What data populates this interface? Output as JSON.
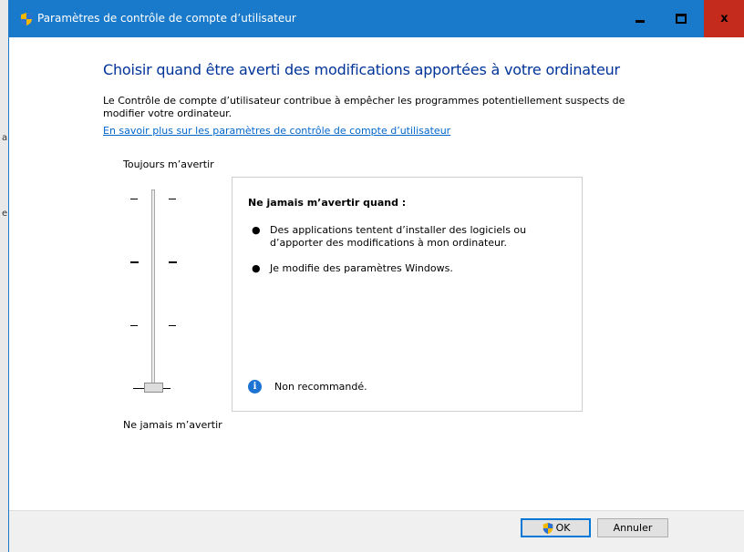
{
  "window": {
    "title": "Paramètres de contrôle de compte d’utilisateur",
    "accent": "#1979ca"
  },
  "main": {
    "heading": "Choisir quand être averti des modifications apportées à votre ordinateur",
    "description": "Le Contrôle de compte d’utilisateur contribue à empêcher les programmes potentiellement suspects de modifier votre ordinateur.",
    "learn_more_link": "En savoir plus sur les paramètres de contrôle de compte d’utilisateur"
  },
  "slider": {
    "top_label": "Toujours m’avertir",
    "bottom_label": "Ne jamais m’avertir",
    "levels": 4,
    "selected_level": 1
  },
  "info": {
    "title": "Ne jamais m’avertir quand :",
    "items": [
      "Des applications tentent d’installer des logiciels ou d’apporter des modifications à mon ordinateur.",
      "Je modifie des paramètres Windows."
    ],
    "note": "Non recommandé."
  },
  "buttons": {
    "ok": "OK",
    "cancel": "Annuler"
  },
  "icons": {
    "title": "uac-shield-icon",
    "info": "info-icon",
    "ok": "uac-shield-icon"
  },
  "backdrop": {
    "fragment_1": "a",
    "fragment_2": "e"
  }
}
